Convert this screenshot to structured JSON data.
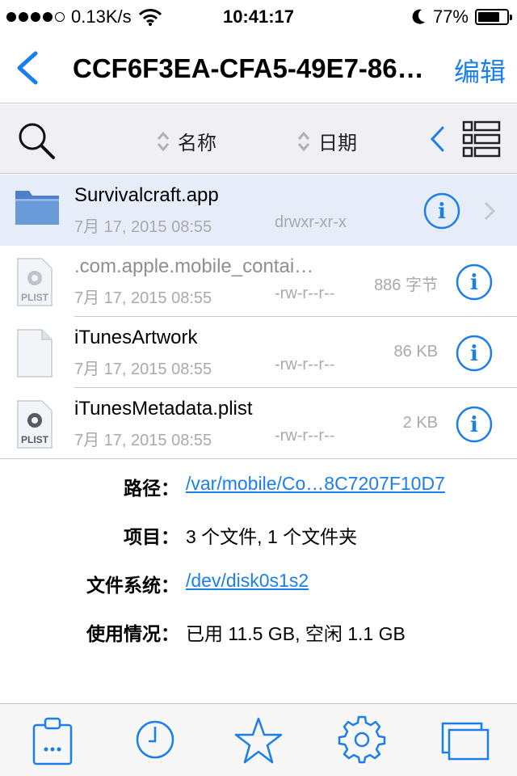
{
  "status": {
    "signal_bars": 4,
    "signal_total": 5,
    "speed": "0.13K/s",
    "time": "10:41:17",
    "battery": "77%",
    "battery_level": 0.77
  },
  "nav": {
    "title": "CCF6F3EA-CFA5-49E7-86…",
    "edit": "编辑"
  },
  "toolbar": {
    "sort_name": "名称",
    "sort_date": "日期"
  },
  "files": [
    {
      "name": "Survivalcraft.app",
      "date": "7月 17, 2015 08:55",
      "perm": "drwxr-xr-x",
      "size": "",
      "icon": "folder-icon",
      "selected": true
    },
    {
      "name": ".com.apple.mobile_contai…",
      "date": "7月 17, 2015 08:55",
      "perm": "-rw-r--r--",
      "size": "886 字节",
      "icon": "plist-file-icon",
      "selected": false
    },
    {
      "name": "iTunesArtwork",
      "date": "7月 17, 2015 08:55",
      "perm": "-rw-r--r--",
      "size": "86 KB",
      "icon": "blank-file-icon",
      "selected": false
    },
    {
      "name": "iTunesMetadata.plist",
      "date": "7月 17, 2015 08:55",
      "perm": "-rw-r--r--",
      "size": "2 KB",
      "icon": "plist-file-icon",
      "selected": false
    }
  ],
  "details": {
    "path_label": "路径：",
    "path_value": "/var/mobile/Co…8C7207F10D7",
    "items_label": "项目：",
    "items_value": "3 个文件, 1 个文件夹",
    "fs_label": "文件系统：",
    "fs_value": "/dev/disk0s1s2",
    "usage_label": "使用情况：",
    "usage_value": "已用 11.5 GB, 空闲 1.1 GB"
  },
  "tabbar": [
    "clipboard-icon",
    "clock-icon",
    "star-icon",
    "gear-icon",
    "windows-icon"
  ],
  "colors": {
    "accent": "#1a7fe8",
    "selected_row": "#e6edf9",
    "toolbar_bg": "#efeff4"
  }
}
